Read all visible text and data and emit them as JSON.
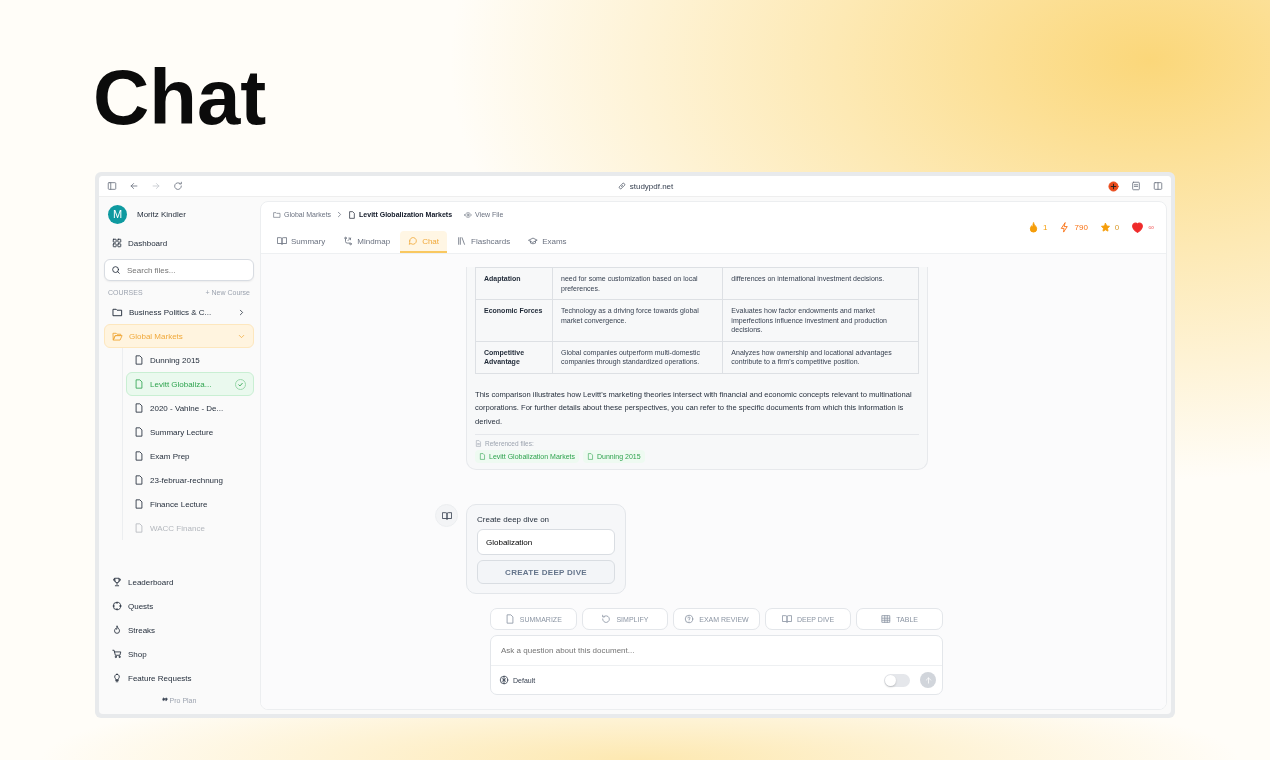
{
  "heading": "Chat",
  "browser": {
    "url": "studypdf.net"
  },
  "user": {
    "initial": "M",
    "name": "Moritz Kindler"
  },
  "sidebar": {
    "dashboard": "Dashboard",
    "search": {
      "placeholder": "Search files..."
    },
    "courses_label": "COURSES",
    "new_course": "+ New Course",
    "courses": [
      {
        "name": "Business Politics & C...",
        "expanded": false,
        "selected": false
      },
      {
        "name": "Global Markets",
        "expanded": true,
        "selected": true,
        "children": [
          {
            "name": "Dunning 2015",
            "selected": false,
            "dimmed": false
          },
          {
            "name": "Levitt Globaliza...",
            "selected": true,
            "dimmed": false
          },
          {
            "name": "2020 - Vahlne - De...",
            "selected": false,
            "dimmed": false
          },
          {
            "name": "Summary Lecture",
            "selected": false,
            "dimmed": false
          },
          {
            "name": "Exam Prep",
            "selected": false,
            "dimmed": false
          },
          {
            "name": "23-februar-rechnung",
            "selected": false,
            "dimmed": false
          },
          {
            "name": "Finance Lecture",
            "selected": false,
            "dimmed": false
          },
          {
            "name": "WACC Finance",
            "selected": false,
            "dimmed": true
          }
        ]
      }
    ],
    "nav": [
      "Leaderboard",
      "Quests",
      "Streaks",
      "Shop",
      "Feature Requests"
    ],
    "plan": "Pro Plan"
  },
  "breadcrumb": [
    {
      "label": "Global Markets",
      "current": false
    },
    {
      "label": "Levitt Globalization Markets",
      "current": true
    }
  ],
  "view_file": "View File",
  "tabs": [
    {
      "label": "Summary",
      "selected": false
    },
    {
      "label": "Mindmap",
      "selected": false
    },
    {
      "label": "Chat",
      "selected": true
    },
    {
      "label": "Flashcards",
      "selected": false
    },
    {
      "label": "Exams",
      "selected": false
    }
  ],
  "stats": [
    "1",
    "790",
    "0",
    "∞"
  ],
  "table": {
    "rows": [
      [
        "Adaptation",
        "need for some customization based on local preferences.",
        "differences on international investment decisions."
      ],
      [
        "Economic Forces",
        "Technology as a driving force towards global market convergence.",
        "Evaluates how factor endowments and market imperfections influence investment and production decisions."
      ],
      [
        "Competitive Advantage",
        "Global companies outperform multi-domestic companies through standardized operations.",
        "Analyzes how ownership and locational advantages contribute to a firm's competitive position."
      ]
    ]
  },
  "answer": "This comparison illustrates how Levitt's marketing theories intersect with financial and economic concepts relevant to multinational corporations. For further details about these perspectives, you can refer to the specific documents from which this information is derived.",
  "referenced_label": "Referenced files:",
  "referenced": [
    "Levitt Globalization Markets",
    "Dunning 2015"
  ],
  "deep_dive": {
    "label": "Create deep dive on",
    "value": "Globalization",
    "button": "CREATE DEEP DIVE"
  },
  "quick_actions": [
    "SUMMARIZE",
    "SIMPLIFY",
    "EXAM REVIEW",
    "DEEP DIVE",
    "TABLE"
  ],
  "composer": {
    "placeholder": "Ask a question about this document...",
    "mode": "Default",
    "toggle_on": false
  }
}
